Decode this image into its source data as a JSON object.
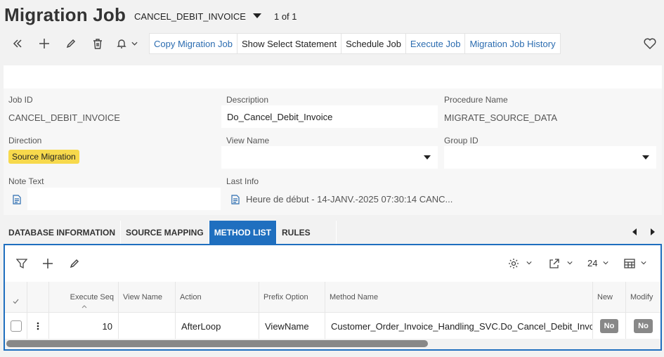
{
  "header": {
    "title": "Migration Job",
    "record_key": "CANCEL_DEBIT_INVOICE",
    "record_count": "1 of 1"
  },
  "toolbar": {
    "icons": [
      "collapse-icon",
      "plus-icon",
      "pencil-icon",
      "trash-icon",
      "bell-icon"
    ],
    "commands": [
      {
        "label": "Copy Migration Job",
        "style": "link"
      },
      {
        "label": "Show Select Statement",
        "style": "plain"
      },
      {
        "label": "Schedule Job",
        "style": "plain"
      },
      {
        "label": "Execute Job",
        "style": "link"
      },
      {
        "label": "Migration Job History",
        "style": "link"
      }
    ]
  },
  "form": {
    "job_id_label": "Job ID",
    "job_id_value": "CANCEL_DEBIT_INVOICE",
    "description_label": "Description",
    "description_value": "Do_Cancel_Debit_Invoice",
    "procedure_label": "Procedure Name",
    "procedure_value": "MIGRATE_SOURCE_DATA",
    "direction_label": "Direction",
    "direction_value": "Source Migration",
    "view_name_label": "View Name",
    "view_name_value": "",
    "group_id_label": "Group ID",
    "group_id_value": "",
    "note_text_label": "Note Text",
    "last_info_label": "Last Info",
    "last_info_value": "Heure de début - 14-JANV.-2025 07:30:14 CANC..."
  },
  "tabs": [
    {
      "label": "DATABASE INFORMATION",
      "active": false
    },
    {
      "label": "SOURCE MAPPING",
      "active": false
    },
    {
      "label": "METHOD LIST",
      "active": true
    },
    {
      "label": "RULES",
      "active": false
    }
  ],
  "list": {
    "page_size": "24",
    "columns": [
      "Execute Seq",
      "View Name",
      "Action",
      "Prefix Option",
      "Method Name",
      "New",
      "Modify"
    ],
    "rows": [
      {
        "execute_seq": "10",
        "view_name": "",
        "action": "AfterLoop",
        "prefix_option": "ViewName",
        "method_name": "Customer_Order_Invoice_Handling_SVC.Do_Cancel_Debit_Invoice",
        "new": "No",
        "modify": "No"
      }
    ]
  },
  "colors": {
    "accent": "#1f6fbf",
    "link": "#2b6cb0",
    "badge": "#f7d94c"
  }
}
